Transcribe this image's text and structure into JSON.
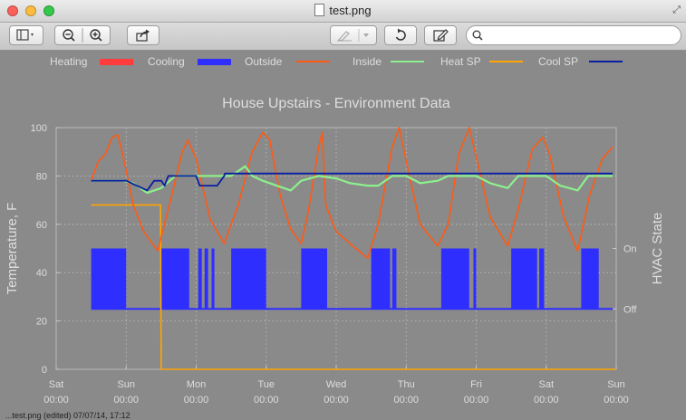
{
  "window": {
    "title": "test.png"
  },
  "toolbar": {
    "sidebar_icon": "sidebar-icon",
    "zoom_out_icon": "zoom-out-icon",
    "zoom_in_icon": "zoom-in-icon",
    "share_icon": "share-icon",
    "markup_icon": "markup-pen-icon",
    "rotate_icon": "rotate-icon",
    "edit_icon": "edit-pencil-icon",
    "search_icon": "search-icon"
  },
  "chart_data": {
    "type": "line",
    "title": "House Upstairs - Environment Data",
    "ylabel": "Temperature, F",
    "y2label": "HVAC State",
    "ylim": [
      0,
      100
    ],
    "yticks": [
      "0",
      "20",
      "40",
      "60",
      "80",
      "100"
    ],
    "y2ticks": [
      "On",
      "Off"
    ],
    "y2_levels": {
      "On": 50,
      "Off": 25
    },
    "xlim": [
      0,
      8
    ],
    "xticks": [
      {
        "day": "Sat",
        "time": "00:00"
      },
      {
        "day": "Sun",
        "time": "00:00"
      },
      {
        "day": "Mon",
        "time": "00:00"
      },
      {
        "day": "Tue",
        "time": "00:00"
      },
      {
        "day": "Wed",
        "time": "00:00"
      },
      {
        "day": "Thu",
        "time": "00:00"
      },
      {
        "day": "Fri",
        "time": "00:00"
      },
      {
        "day": "Sat",
        "time": "00:00"
      },
      {
        "day": "Sun",
        "time": "00:00"
      }
    ],
    "grid": true,
    "legend_position": "top",
    "colors": {
      "heating": "#ff3b3b",
      "cooling": "#2e2eff",
      "outside": "#ff5a14",
      "inside": "#8cf08c",
      "heat_sp": "#ffa500",
      "cool_sp": "#0a1fa0",
      "background": "#8a8a8a",
      "text": "#dedede"
    },
    "series": [
      {
        "name": "Heating",
        "kind": "state",
        "on_intervals": []
      },
      {
        "name": "Cooling",
        "kind": "state",
        "on_intervals": [
          [
            0.5,
            1.0
          ],
          [
            1.5,
            1.9
          ],
          [
            2.03,
            2.08
          ],
          [
            2.12,
            2.17
          ],
          [
            2.22,
            2.26
          ],
          [
            2.5,
            3.0
          ],
          [
            3.5,
            3.87
          ],
          [
            4.5,
            4.77
          ],
          [
            4.8,
            4.86
          ],
          [
            5.5,
            5.9
          ],
          [
            5.96,
            6.0
          ],
          [
            6.5,
            6.87
          ],
          [
            6.9,
            6.97
          ],
          [
            7.5,
            7.75
          ]
        ]
      },
      {
        "name": "Outside",
        "x": [
          0.5,
          0.6,
          0.7,
          0.8,
          0.88,
          0.98,
          1.1,
          1.25,
          1.45,
          1.65,
          1.8,
          1.88,
          2.0,
          2.2,
          2.4,
          2.6,
          2.8,
          2.95,
          3.05,
          3.2,
          3.35,
          3.5,
          3.6,
          3.75,
          3.8,
          3.85,
          4.0,
          4.2,
          4.45,
          4.6,
          4.8,
          4.9,
          5.0,
          5.2,
          5.45,
          5.6,
          5.75,
          5.9,
          6.0,
          6.2,
          6.45,
          6.6,
          6.8,
          6.95,
          7.05,
          7.25,
          7.45,
          7.62,
          7.8,
          7.95
        ],
        "values": [
          78,
          86,
          89,
          96,
          97,
          85,
          68,
          57,
          49,
          72,
          90,
          95,
          87,
          62,
          52,
          68,
          90,
          98,
          95,
          72,
          58,
          52,
          65,
          92,
          98,
          68,
          57,
          52,
          46,
          60,
          92,
          100,
          86,
          60,
          51,
          60,
          89,
          100,
          88,
          63,
          51,
          66,
          91,
          96,
          89,
          63,
          49,
          72,
          87,
          92
        ]
      },
      {
        "name": "Inside",
        "x": [
          0.5,
          0.75,
          0.95,
          1.1,
          1.3,
          1.5,
          1.7,
          1.85,
          2.0,
          2.2,
          2.5,
          2.7,
          2.8,
          2.95,
          3.15,
          3.35,
          3.5,
          3.75,
          4.0,
          4.2,
          4.45,
          4.6,
          4.8,
          5.0,
          5.2,
          5.45,
          5.6,
          5.8,
          6.0,
          6.2,
          6.45,
          6.6,
          6.8,
          7.0,
          7.2,
          7.45,
          7.6,
          7.8,
          7.95
        ],
        "values": [
          78,
          78,
          78,
          77,
          73,
          75,
          80,
          80,
          80,
          80,
          80,
          84,
          80,
          78,
          76,
          74,
          78,
          80,
          79,
          77,
          76,
          76,
          80,
          80,
          77,
          78,
          80,
          80,
          80,
          77,
          75,
          80,
          80,
          80,
          76,
          74,
          80,
          80,
          80
        ]
      },
      {
        "name": "Heat SP",
        "x": [
          0.5,
          1.49,
          1.5,
          8.0
        ],
        "values": [
          68,
          68,
          0,
          0
        ]
      },
      {
        "name": "Cool SP",
        "x": [
          0.5,
          1.0,
          1.15,
          1.3,
          1.4,
          1.5,
          1.55,
          1.6,
          2.0,
          2.05,
          2.3,
          2.4,
          2.41,
          7.95
        ],
        "values": [
          78,
          78,
          76,
          74,
          78,
          78,
          76,
          80,
          80,
          76,
          76,
          80,
          81,
          81
        ]
      }
    ]
  },
  "status_text": "...test.png (edited) 07/07/14, 17:12"
}
